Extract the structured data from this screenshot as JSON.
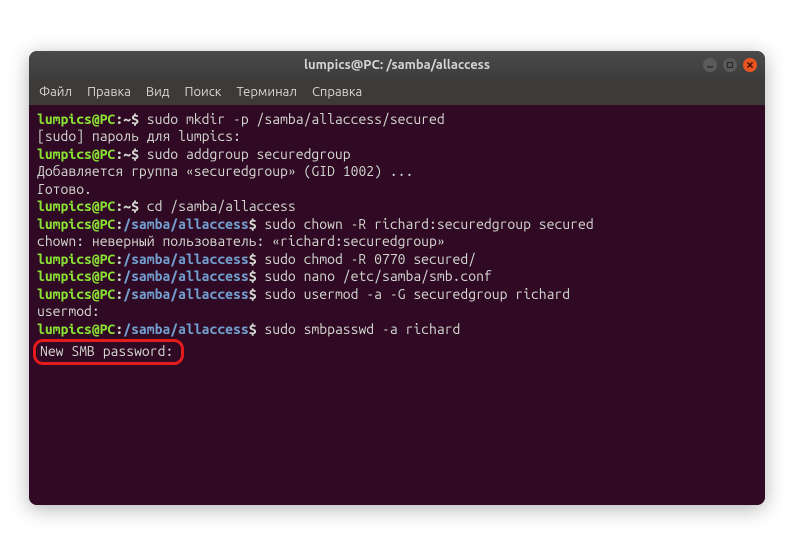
{
  "window": {
    "title": "lumpics@PC: /samba/allaccess"
  },
  "menu": {
    "file": "Файл",
    "edit": "Правка",
    "view": "Вид",
    "search": "Поиск",
    "terminal": "Терминал",
    "help": "Справка"
  },
  "prompt": {
    "user_host": "lumpics@PC",
    "home": "~",
    "path": "/samba/allaccess",
    "dollar": "$"
  },
  "lines": {
    "l01_cmd": " sudo mkdir -p /samba/allaccess/secured",
    "l02_out": "[sudo] пароль для lumpics:",
    "l03_cmd": " sudo addgroup securedgroup",
    "l04_out": "Добавляется группа «securedgroup» (GID 1002) ...",
    "l05_out": "Готово.",
    "l06_cmd": " cd /samba/allaccess",
    "l07_cmd": " sudo chown -R richard:securedgroup secured",
    "l08_out": "chown: неверный пользователь: «richard:securedgroup»",
    "l09_cmd": " sudo chmod -R 0770 secured/",
    "l10_cmd": " sudo nano /etc/samba/smb.conf",
    "l11_cmd": " sudo usermod -a -G securedgroup richard",
    "l12_out": "usermod:",
    "l13_cmd": " sudo smbpasswd -a richard",
    "l14_out": "New SMB password:"
  }
}
